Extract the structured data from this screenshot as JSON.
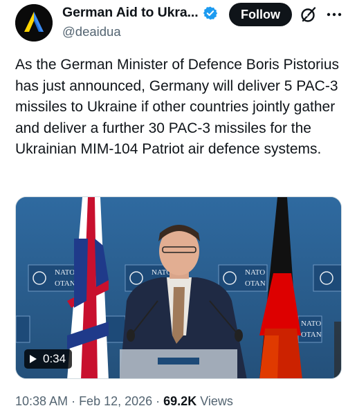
{
  "author": {
    "display_name": "German Aid to Ukra...",
    "handle": "@deaidua",
    "avatar_icon": "yellow-blue-chevron-logo",
    "verified_icon": "verified-badge-icon",
    "verified_color": "#1d9bf0"
  },
  "header": {
    "follow_label": "Follow",
    "grok_icon": "grok-icon",
    "more_icon": "more-horizontal-icon"
  },
  "tweet": {
    "text": "As the German Minister of Defence Boris Pistorius has just announced, Germany will deliver 5 PAC-3 missiles to Ukraine if other countries jointly gather and deliver a further 30 PAC-3 missiles for the Ukrainian MIM-104 Patriot air defence systems."
  },
  "media": {
    "duration": "0:34",
    "play_icon": "play-icon",
    "backdrop_label_1": "NATO",
    "backdrop_label_2": "OTAN"
  },
  "meta": {
    "time": "10:38 AM",
    "separator_1": " · ",
    "date": "Feb 12, 2026",
    "separator_2": " · ",
    "views_count": "69.2K",
    "views_label": " Views"
  },
  "colors": {
    "text_primary": "#0f1419",
    "text_secondary": "#536471",
    "follow_button": "#0f1419",
    "verified": "#1d9bf0",
    "backdrop_blue": "#2c5d8d"
  }
}
